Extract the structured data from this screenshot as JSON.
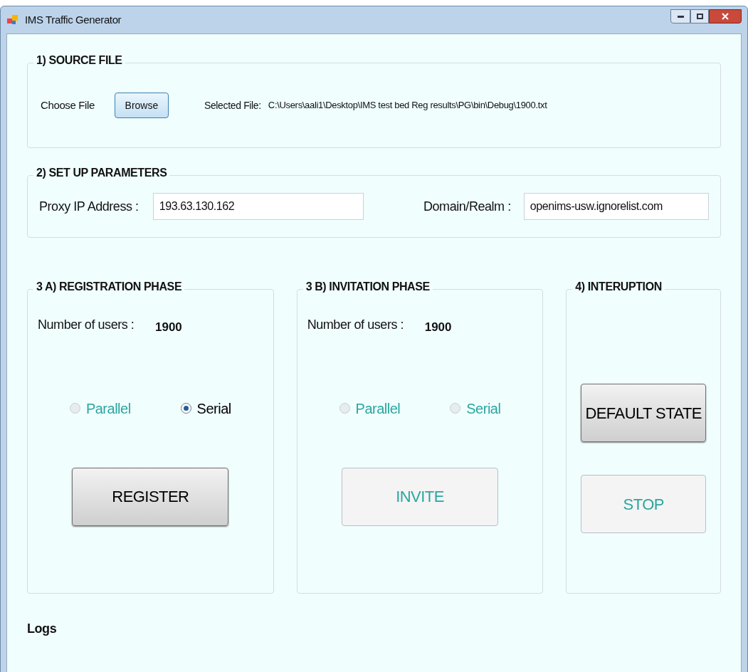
{
  "window": {
    "title": "IMS Traffic Generator"
  },
  "source_file": {
    "title": "1) SOURCE FILE",
    "choose_label": "Choose File",
    "browse_button": "Browse",
    "selected_label": "Selected File:",
    "selected_path": "C:\\Users\\aali1\\Desktop\\IMS test bed Reg results\\PG\\bin\\Debug\\1900.txt"
  },
  "parameters": {
    "title": "2) SET UP PARAMETERS",
    "fields": [
      {
        "label": "Proxy IP Address :",
        "value": "193.63.130.162"
      },
      {
        "label": "Domain/Realm :",
        "value": "openims-usw.ignorelist.com"
      }
    ]
  },
  "phases": [
    {
      "title": "3 A) REGISTRATION PHASE",
      "users_label": "Number of users :",
      "users_value": "1900",
      "options": [
        {
          "label": "Parallel",
          "selected": false,
          "disabled": true
        },
        {
          "label": "Serial",
          "selected": true,
          "disabled": false
        }
      ],
      "button": {
        "label": "REGISTER",
        "disabled": false
      }
    },
    {
      "title": "3 B) INVITATION PHASE",
      "users_label": "Number of users :",
      "users_value": "1900",
      "options": [
        {
          "label": "Parallel",
          "selected": false,
          "disabled": true
        },
        {
          "label": "Serial",
          "selected": false,
          "disabled": true
        }
      ],
      "button": {
        "label": "INVITE",
        "disabled": true
      }
    }
  ],
  "interruption": {
    "title": "4) INTERUPTION",
    "buttons": [
      {
        "label": "DEFAULT STATE",
        "disabled": false
      },
      {
        "label": "STOP",
        "disabled": true
      }
    ]
  },
  "logs": {
    "label": "Logs"
  }
}
